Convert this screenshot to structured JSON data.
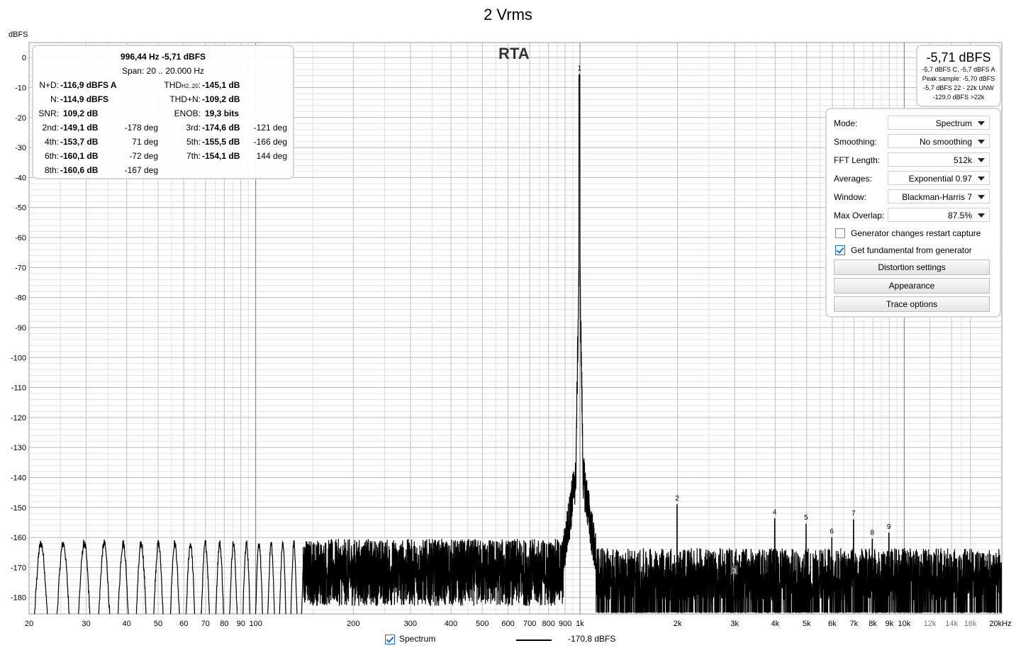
{
  "title": "2 Vrms",
  "rta_label": "RTA",
  "y_unit": "dBFS",
  "measurements": {
    "fundamental": "996,44 Hz  -5,71 dBFS",
    "span": "Span: 20 .. 20.000 Hz",
    "nd_label": "N+D:",
    "nd_value": "-116,9 dBFS A",
    "thd_label": "THD",
    "thd_sub": "H2..20",
    "thd_colon": ":",
    "thd_value": "-145,1 dB",
    "n_label": "N:",
    "n_value": "-114,9 dBFS",
    "thdn_label": "THD+N:",
    "thdn_value": "-109,2 dB",
    "snr_label": "SNR:",
    "snr_value": "109,2 dB",
    "enob_label": "ENOB:",
    "enob_value": "19,3 bits",
    "harmonics": [
      {
        "label": "2nd:",
        "value": "-149,1 dB",
        "phase": "-178 deg"
      },
      {
        "label": "3rd:",
        "value": "-174,6 dB",
        "phase": "-121 deg"
      },
      {
        "label": "4th:",
        "value": "-153,7 dB",
        "phase": "71 deg"
      },
      {
        "label": "5th:",
        "value": "-155,5 dB",
        "phase": "-166 deg"
      },
      {
        "label": "6th:",
        "value": "-160,1 dB",
        "phase": "-72 deg"
      },
      {
        "label": "7th:",
        "value": "-154,1 dB",
        "phase": "144 deg"
      },
      {
        "label": "8th:",
        "value": "-160,6 dB",
        "phase": "-167 deg"
      }
    ]
  },
  "peak": {
    "big": "-5,71 dBFS",
    "lines": [
      "-5,7 dBFS C, -5,7 dBFS A",
      "Peak sample: -5,70 dBFS",
      "-5,7 dBFS 22 - 22k UNW",
      "-129,0 dBFS >22k"
    ]
  },
  "controls": {
    "rows": [
      {
        "label": "Mode:",
        "value": "Spectrum"
      },
      {
        "label": "Smoothing:",
        "value": "No smoothing"
      },
      {
        "label": "FFT Length:",
        "value": "512k"
      },
      {
        "label": "Averages:",
        "value": "Exponential 0.97"
      },
      {
        "label": "Window:",
        "value": "Blackman-Harris 7"
      },
      {
        "label": "Max Overlap:",
        "value": "87.5%"
      }
    ],
    "checkbox1": {
      "label": "Generator changes restart capture",
      "checked": false
    },
    "checkbox2": {
      "label": "Get fundamental from generator",
      "checked": true
    },
    "buttons": [
      "Distortion settings",
      "Appearance",
      "Trace options"
    ]
  },
  "legend": {
    "series_label": "Spectrum",
    "cursor_value": "-170,8 dBFS"
  },
  "colors": {
    "trace": "#000000",
    "grid_major": "#a8a8a8",
    "grid_minor": "#e2e2e2",
    "accent": "#1f6fd1"
  },
  "chart_data": {
    "type": "line",
    "title": "2 Vrms",
    "ylabel": "dBFS",
    "xscale": "log",
    "xlim": [
      20,
      20000
    ],
    "ylim": [
      -190,
      5
    ],
    "y_ticks": [
      0,
      -10,
      -20,
      -30,
      -40,
      -50,
      -60,
      -70,
      -80,
      -90,
      -100,
      -110,
      -120,
      -130,
      -140,
      -150,
      -160,
      -170,
      -180
    ],
    "x_ticks": [
      {
        "v": 20,
        "t": "20"
      },
      {
        "v": 30,
        "t": "30"
      },
      {
        "v": 40,
        "t": "40"
      },
      {
        "v": 50,
        "t": "50"
      },
      {
        "v": 60,
        "t": "60"
      },
      {
        "v": 70,
        "t": "70"
      },
      {
        "v": 80,
        "t": "80"
      },
      {
        "v": 90,
        "t": "90"
      },
      {
        "v": 100,
        "t": "100"
      },
      {
        "v": 200,
        "t": "200"
      },
      {
        "v": 300,
        "t": "300"
      },
      {
        "v": 400,
        "t": "400"
      },
      {
        "v": 500,
        "t": "500"
      },
      {
        "v": 600,
        "t": "600"
      },
      {
        "v": 700,
        "t": "700"
      },
      {
        "v": 800,
        "t": "800"
      },
      {
        "v": 900,
        "t": "900"
      },
      {
        "v": 1000,
        "t": "1k"
      },
      {
        "v": 2000,
        "t": "2k"
      },
      {
        "v": 3000,
        "t": "3k"
      },
      {
        "v": 4000,
        "t": "4k"
      },
      {
        "v": 5000,
        "t": "5k"
      },
      {
        "v": 6000,
        "t": "6k"
      },
      {
        "v": 7000,
        "t": "7k"
      },
      {
        "v": 8000,
        "t": "8k"
      },
      {
        "v": 9000,
        "t": "9k"
      },
      {
        "v": 10000,
        "t": "10k"
      },
      {
        "v": 12000,
        "t": "12k"
      },
      {
        "v": 14000,
        "t": "14k"
      },
      {
        "v": 16000,
        "t": "16k"
      },
      {
        "v": 20000,
        "t": "20kHz"
      }
    ],
    "harmonic_markers": [
      {
        "label": "1",
        "f": 996.44,
        "db": -5.7
      },
      {
        "label": "2",
        "f": 1993,
        "db": -149.1
      },
      {
        "label": "3",
        "f": 2989,
        "db": -174.6
      },
      {
        "label": "4",
        "f": 3986,
        "db": -153.7
      },
      {
        "label": "5",
        "f": 4982,
        "db": -155.5
      },
      {
        "label": "6",
        "f": 5979,
        "db": -160.1
      },
      {
        "label": "7",
        "f": 6975,
        "db": -154.1
      },
      {
        "label": "8",
        "f": 7972,
        "db": -160.6
      },
      {
        "label": "9",
        "f": 8968,
        "db": -158.5
      }
    ],
    "series": [
      {
        "name": "Spectrum",
        "fundamental_hz": 996.44,
        "fundamental_dbfs": -5.71,
        "noise_floor_dbfs": -170
      }
    ]
  }
}
